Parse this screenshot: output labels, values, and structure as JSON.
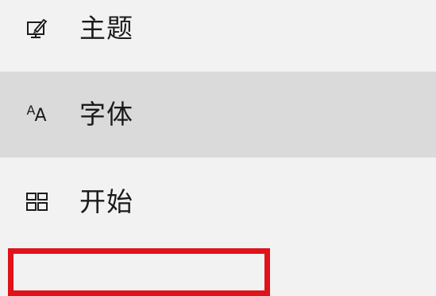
{
  "nav": {
    "items": [
      {
        "label": "主题",
        "icon": "theme-brush-icon",
        "selected": false
      },
      {
        "label": "字体",
        "icon": "font-icon",
        "selected": true
      },
      {
        "label": "开始",
        "icon": "start-grid-icon",
        "selected": false
      }
    ]
  },
  "font_icon": {
    "small": "A",
    "large": "A"
  },
  "colors": {
    "background": "#f2f2f2",
    "selected_background": "#dadada",
    "highlight_border": "#e0121a",
    "text": "#1b1b1b"
  }
}
